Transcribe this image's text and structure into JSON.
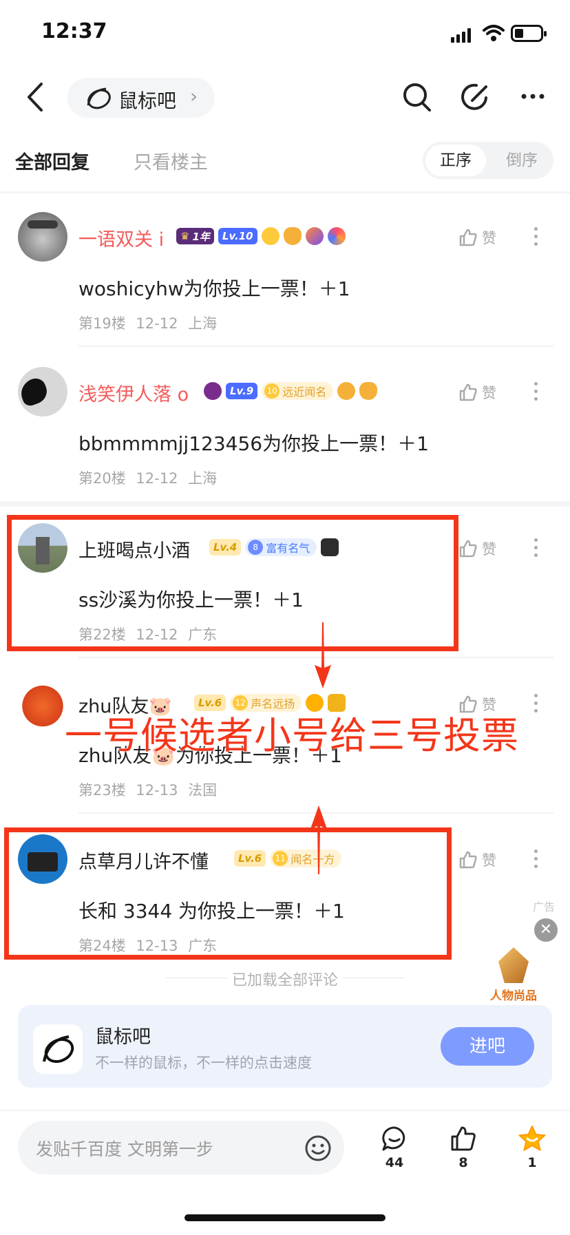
{
  "status_bar": {
    "time": "12:37"
  },
  "nav": {
    "forum_name": "鼠标吧"
  },
  "tabs": {
    "all_replies": "全部回复",
    "owner_only": "只看楼主",
    "sort_asc": "正序",
    "sort_desc": "倒序"
  },
  "comments": [
    {
      "username": "一语双关 i",
      "username_color": "#f45b5b",
      "badge_year": "1年",
      "badge_level": "Lv.10",
      "text": "woshicyhw为你投上一票！＋1",
      "floor": "第19楼",
      "date": "12-12",
      "location": "上海",
      "like_label": "赞"
    },
    {
      "username": "浅笑伊人落 o",
      "username_color": "#f45b5b",
      "badge_level": "Lv.9",
      "badge_title": "远近闻名",
      "text": "bbmmmmjj123456为你投上一票！＋1",
      "floor": "第20楼",
      "date": "12-12",
      "location": "上海",
      "like_label": "赞"
    },
    {
      "username": "上班喝点小酒",
      "username_color": "#222222",
      "badge_level": "Lv.4",
      "badge_title": "富有名气",
      "text": "ss沙溪为你投上一票！＋1",
      "floor": "第22楼",
      "date": "12-12",
      "location": "广东",
      "like_label": "赞"
    },
    {
      "username": "zhu队友🐷",
      "username_color": "#222222",
      "badge_level": "Lv.6",
      "badge_title": "声名远扬",
      "text": "zhu队友🐷为你投上一票！＋1",
      "floor": "第23楼",
      "date": "12-13",
      "location": "法国",
      "like_label": "赞"
    },
    {
      "username": "点草月儿许不懂",
      "username_color": "#222222",
      "badge_level": "Lv.6",
      "badge_title": "闻名一方",
      "text": "长和 3344 为你投上一票！＋1",
      "floor": "第24楼",
      "date": "12-13",
      "location": "广东",
      "like_label": "赞"
    }
  ],
  "annotation": {
    "overlay_text": "一号候选者小号给三号投票"
  },
  "ad": {
    "label": "广告",
    "brand_text": "人物尚品"
  },
  "footer": {
    "loaded_text": "已加载全部评论",
    "forum_card": {
      "title": "鼠标吧",
      "subtitle": "不一样的鼠标，不一样的点击速度",
      "button": "进吧"
    }
  },
  "bottom_bar": {
    "input_placeholder": "发贴千百度 文明第一步",
    "comment_count": "44",
    "like_count": "8",
    "star_count": "1"
  },
  "colors": {
    "accent_red": "#f3361a",
    "button_blue": "#7e9bff",
    "star_yellow": "#ffb400"
  }
}
